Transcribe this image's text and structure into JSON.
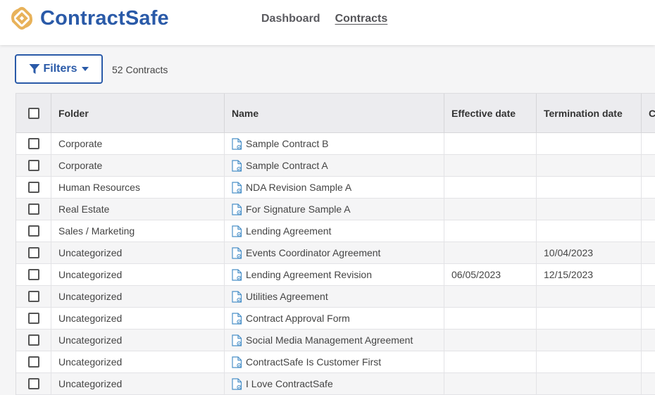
{
  "brand": {
    "name": "ContractSafe"
  },
  "nav": {
    "dashboard": "Dashboard",
    "contracts": "Contracts"
  },
  "toolbar": {
    "filters_label": "Filters",
    "count_label": "52 Contracts"
  },
  "colors": {
    "accent": "#2a5aa8",
    "logo_gold": "#e8b25a",
    "row_alt": "#f5f5f6"
  },
  "table": {
    "columns": {
      "folder": "Folder",
      "name": "Name",
      "effective": "Effective date",
      "termination": "Termination date",
      "extra": "C"
    },
    "rows": [
      {
        "folder": "Corporate",
        "name": "Sample Contract B",
        "effective": "",
        "termination": ""
      },
      {
        "folder": "Corporate",
        "name": "Sample Contract A",
        "effective": "",
        "termination": ""
      },
      {
        "folder": "Human Resources",
        "name": "NDA Revision Sample A",
        "effective": "",
        "termination": ""
      },
      {
        "folder": "Real Estate",
        "name": "For Signature Sample A",
        "effective": "",
        "termination": ""
      },
      {
        "folder": "Sales / Marketing",
        "name": "Lending Agreement",
        "effective": "",
        "termination": ""
      },
      {
        "folder": "Uncategorized",
        "name": "Events Coordinator Agreement",
        "effective": "",
        "termination": "10/04/2023"
      },
      {
        "folder": "Uncategorized",
        "name": "Lending Agreement Revision",
        "effective": "06/05/2023",
        "termination": "12/15/2023"
      },
      {
        "folder": "Uncategorized",
        "name": "Utilities Agreement",
        "effective": "",
        "termination": ""
      },
      {
        "folder": "Uncategorized",
        "name": "Contract Approval Form",
        "effective": "",
        "termination": ""
      },
      {
        "folder": "Uncategorized",
        "name": "Social Media Management Agreement",
        "effective": "",
        "termination": ""
      },
      {
        "folder": "Uncategorized",
        "name": "ContractSafe Is Customer First",
        "effective": "",
        "termination": ""
      },
      {
        "folder": "Uncategorized",
        "name": "I Love ContractSafe",
        "effective": "",
        "termination": ""
      }
    ]
  }
}
